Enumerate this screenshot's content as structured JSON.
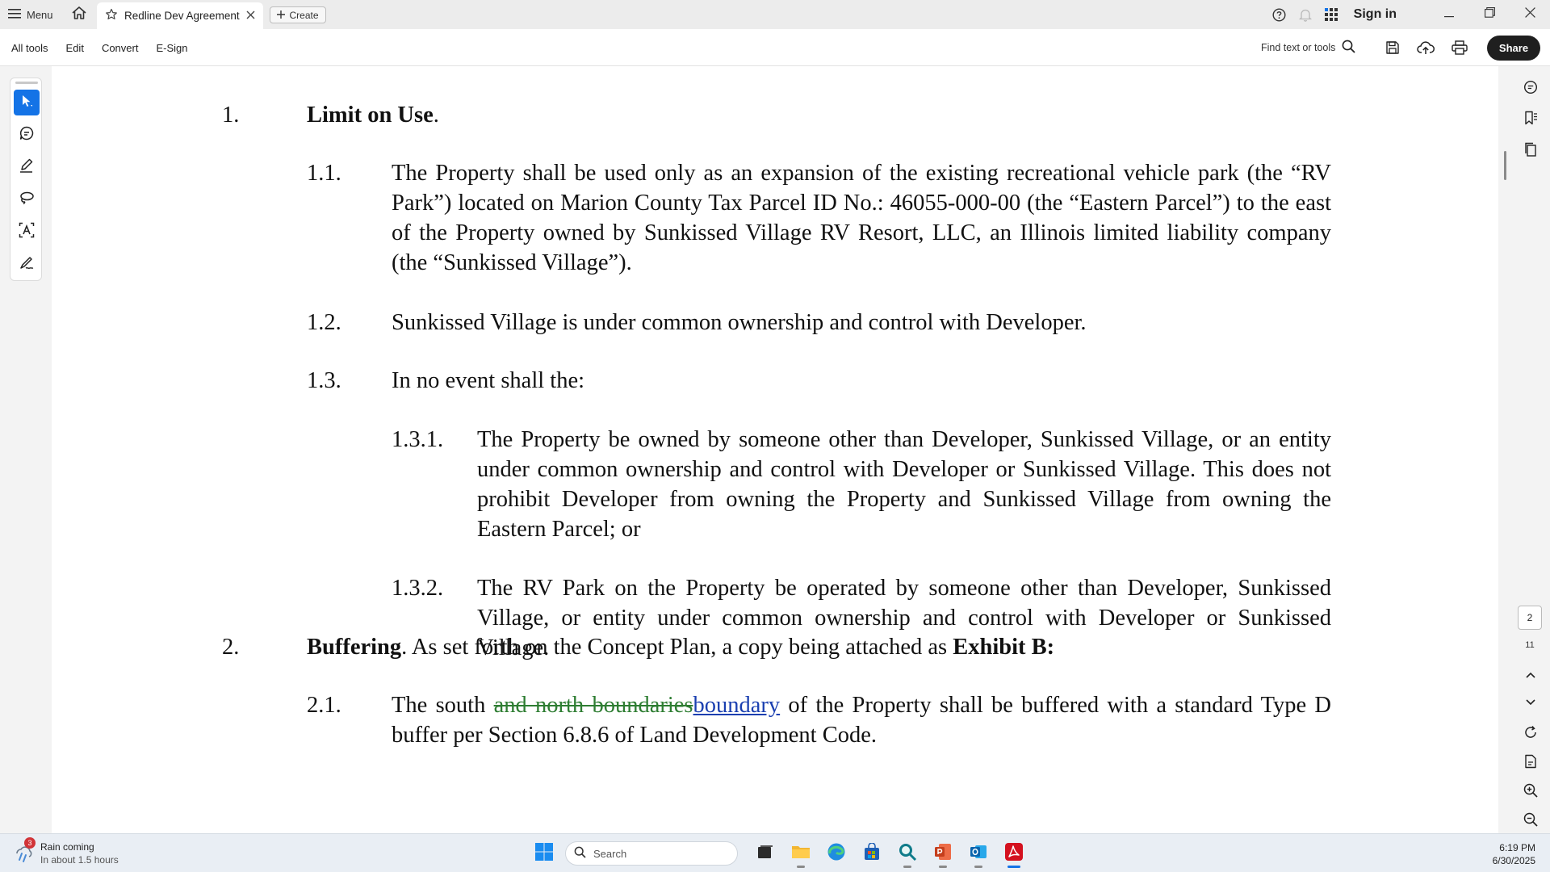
{
  "titlebar": {
    "menu_label": "Menu",
    "tab_title": "Redline Dev Agreement ...",
    "create_label": "Create",
    "signin_label": "Sign in"
  },
  "toolbar": {
    "menu_items": [
      "All tools",
      "Edit",
      "Convert",
      "E-Sign"
    ],
    "find_label": "Find text or tools",
    "share_label": "Share"
  },
  "document": {
    "s1_num": "1.",
    "s1_title": "Limit on Use",
    "s1_title_tail": ".",
    "s1_1_num": "1.1.",
    "s1_1_text": "The Property shall be used only as an expansion of the existing recreational vehicle park (the “RV Park”) located on Marion County Tax Parcel ID No.: 46055-000-00 (the “Eastern Parcel”) to the east of the Property owned by Sunkissed Village RV Resort, LLC, an Illinois limited liability company (the “Sunkissed Village”).",
    "s1_2_num": "1.2.",
    "s1_2_text": "Sunkissed Village is under common ownership and control with Developer.",
    "s1_3_num": "1.3.",
    "s1_3_text": "In no event shall the:",
    "s1_3_1_num": "1.3.1.",
    "s1_3_1_text": "The Property be owned by someone other than Developer, Sunkissed Village, or an entity under common ownership and control with Developer or Sunkissed Village. This does not prohibit Developer from owning the Property and Sunkissed Village from owning the Eastern Parcel; or",
    "s1_3_2_num": "1.3.2.",
    "s1_3_2_text": "The RV Park on the Property be operated by someone other than Developer, Sunkissed Village, or entity under common ownership and control with Developer or Sunkissed Village.",
    "s2_num": "2.",
    "s2_title": "Buffering",
    "s2_text": ". As set forth on the Concept Plan, a copy being attached as ",
    "s2_exhibit": "Exhibit B:",
    "s2_1_num": "2.1.",
    "s2_1_pre": "The south ",
    "s2_1_deleted": "and north boundaries",
    "s2_1_inserted": "boundary",
    "s2_1_post": " of the Property shall be buffered with a standard Type D buffer per Section 6.8.6 of Land Development Code."
  },
  "pager": {
    "current_page": "2",
    "total_pages": "11"
  },
  "taskbar": {
    "weather_badge": "3",
    "weather_title": "Rain coming",
    "weather_sub": "In about 1.5 hours",
    "search_placeholder": "Search",
    "time": "6:19 PM",
    "date": "6/30/2025"
  },
  "colors": {
    "accent": "#1473e6",
    "deleted_text": "#2e7d32",
    "inserted_text": "#1a3fb0",
    "acrobat_red": "#d4111f"
  }
}
